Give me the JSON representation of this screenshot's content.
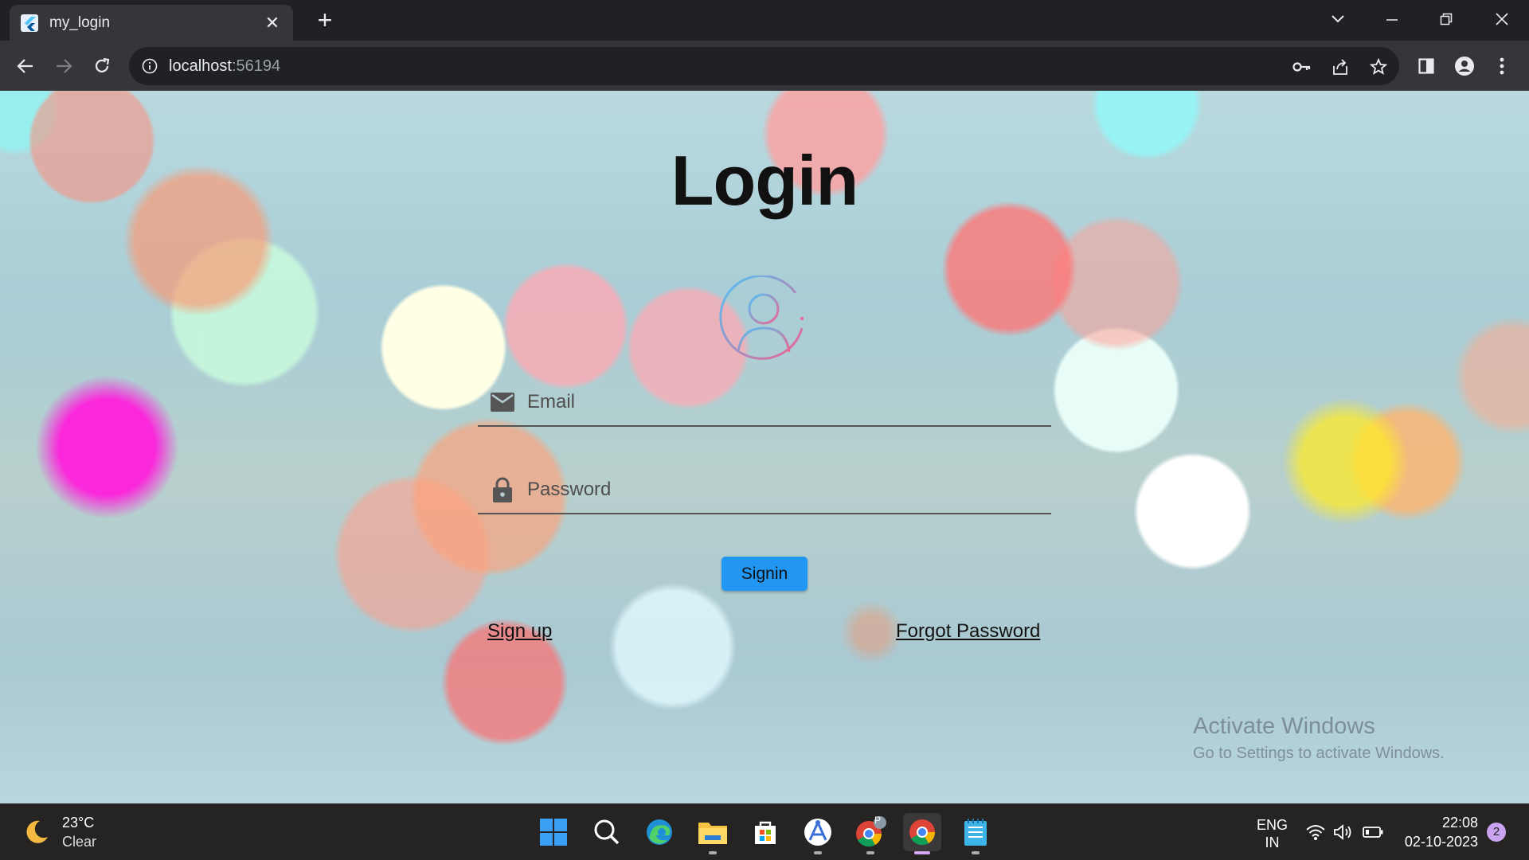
{
  "browser": {
    "tab_title": "my_login",
    "tab_close": "✕",
    "new_tab": "+",
    "url_host": "localhost",
    "url_port": ":56194"
  },
  "page": {
    "title": "Login",
    "email_placeholder": "Email",
    "password_placeholder": "Password",
    "signin_label": "Signin",
    "signup_label": "Sign up",
    "forgot_label": "Forgot Password",
    "watermark_line1": "Activate Windows",
    "watermark_line2": "Go to Settings to activate Windows."
  },
  "taskbar": {
    "temperature": "23°C",
    "weather": "Clear",
    "lang": "ENG",
    "region": "IN",
    "time": "22:08",
    "date": "02-10-2023",
    "notifications": "2",
    "chrome_profile_badge": "P"
  },
  "icons": {
    "accent": "#2196f3",
    "avatar_gradient": [
      "#4fc3f7",
      "#f06292"
    ]
  }
}
